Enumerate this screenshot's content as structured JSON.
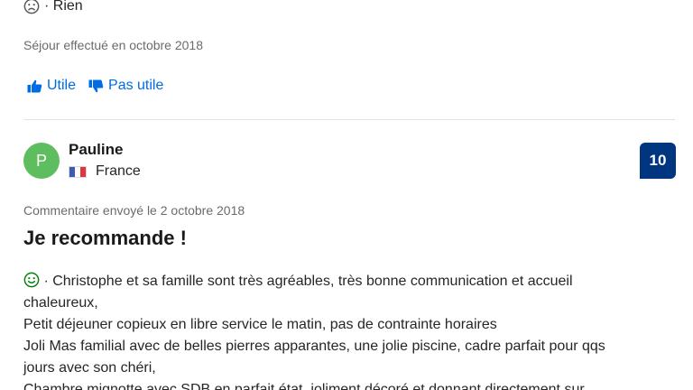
{
  "previous_review": {
    "negative_text": "· Rien",
    "stay_info": "Séjour effectué en octobre 2018",
    "helpful_label": "Utile",
    "not_helpful_label": "Pas utile"
  },
  "review": {
    "avatar_initial": "P",
    "reviewer_name": "Pauline",
    "country": "France",
    "score": "10",
    "comment_date": "Commentaire envoyé le 2 octobre 2018",
    "title": "Je recommande !",
    "positive_lines": [
      "· Christophe et sa famille sont très agréables, très bonne communication et accueil",
      "chaleureux,",
      "Petit déjeuner copieux en libre service le matin, pas de contrainte horaires",
      "Joli Mas familial avec de belles pierres apparantes, une jolie piscine, cadre parfait pour qqs",
      "jours avec son chéri,",
      "Chambre mignotte avec SDB en parfait état, joliment décoré et donnant directement sur"
    ]
  },
  "colors": {
    "link_blue": "#006ce4",
    "score_navy": "#003580",
    "avatar_green": "#5ebd5e",
    "positive_green": "#008009",
    "negative_gray": "#6b6b6b"
  },
  "icons": {
    "negative": "sad-face-icon",
    "positive": "happy-face-icon",
    "helpful": "thumbs-up-icon",
    "not_helpful": "thumbs-down-icon",
    "flag": "france-flag-icon"
  }
}
